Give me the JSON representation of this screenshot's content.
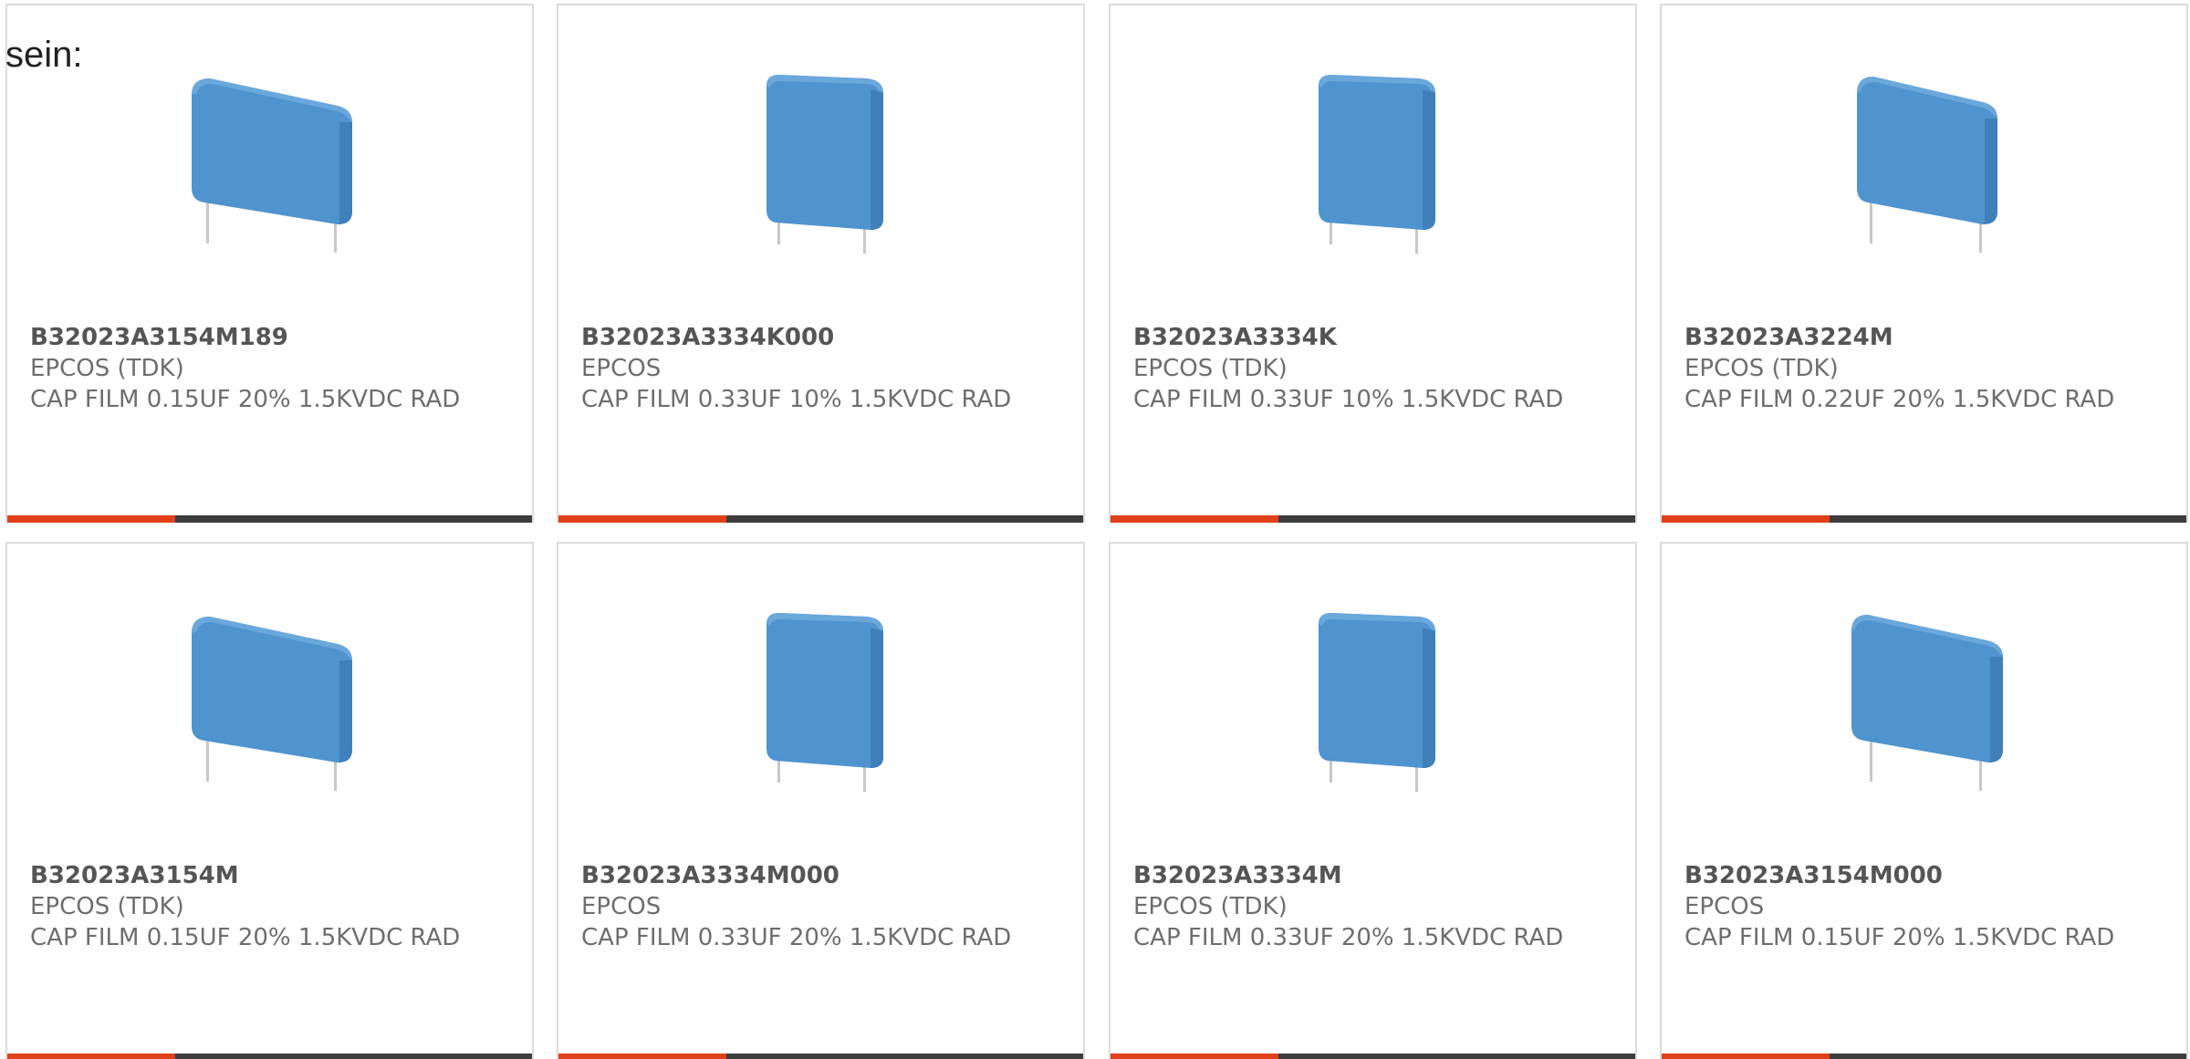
{
  "lead_text": "sein:",
  "colors": {
    "accent": "#e0401a",
    "bar": "#3d3d3d",
    "capacitor_body": "#4f93cf"
  },
  "products": [
    {
      "part_number": "B32023A3154M189",
      "manufacturer": "EPCOS (TDK)",
      "description": "CAP FILM 0.15UF 20% 1.5KVDC RAD",
      "image_icon": "film-capacitor-wide-image"
    },
    {
      "part_number": "B32023A3334K000",
      "manufacturer": "EPCOS",
      "description": "CAP FILM 0.33UF 10% 1.5KVDC RAD",
      "image_icon": "film-capacitor-narrow-image"
    },
    {
      "part_number": "B32023A3334K",
      "manufacturer": "EPCOS (TDK)",
      "description": "CAP FILM 0.33UF 10% 1.5KVDC RAD",
      "image_icon": "film-capacitor-narrow-image"
    },
    {
      "part_number": "B32023A3224M",
      "manufacturer": "EPCOS (TDK)",
      "description": "CAP FILM 0.22UF 20% 1.5KVDC RAD",
      "image_icon": "film-capacitor-wide-image"
    },
    {
      "part_number": "B32023A3154M",
      "manufacturer": "EPCOS (TDK)",
      "description": "CAP FILM 0.15UF 20% 1.5KVDC RAD",
      "image_icon": "film-capacitor-wide-image"
    },
    {
      "part_number": "B32023A3334M000",
      "manufacturer": "EPCOS",
      "description": "CAP FILM 0.33UF 20% 1.5KVDC RAD",
      "image_icon": "film-capacitor-narrow-image"
    },
    {
      "part_number": "B32023A3334M",
      "manufacturer": "EPCOS (TDK)",
      "description": "CAP FILM 0.33UF 20% 1.5KVDC RAD",
      "image_icon": "film-capacitor-narrow-image"
    },
    {
      "part_number": "B32023A3154M000",
      "manufacturer": "EPCOS",
      "description": "CAP FILM 0.15UF 20% 1.5KVDC RAD",
      "image_icon": "film-capacitor-wide-image"
    }
  ]
}
